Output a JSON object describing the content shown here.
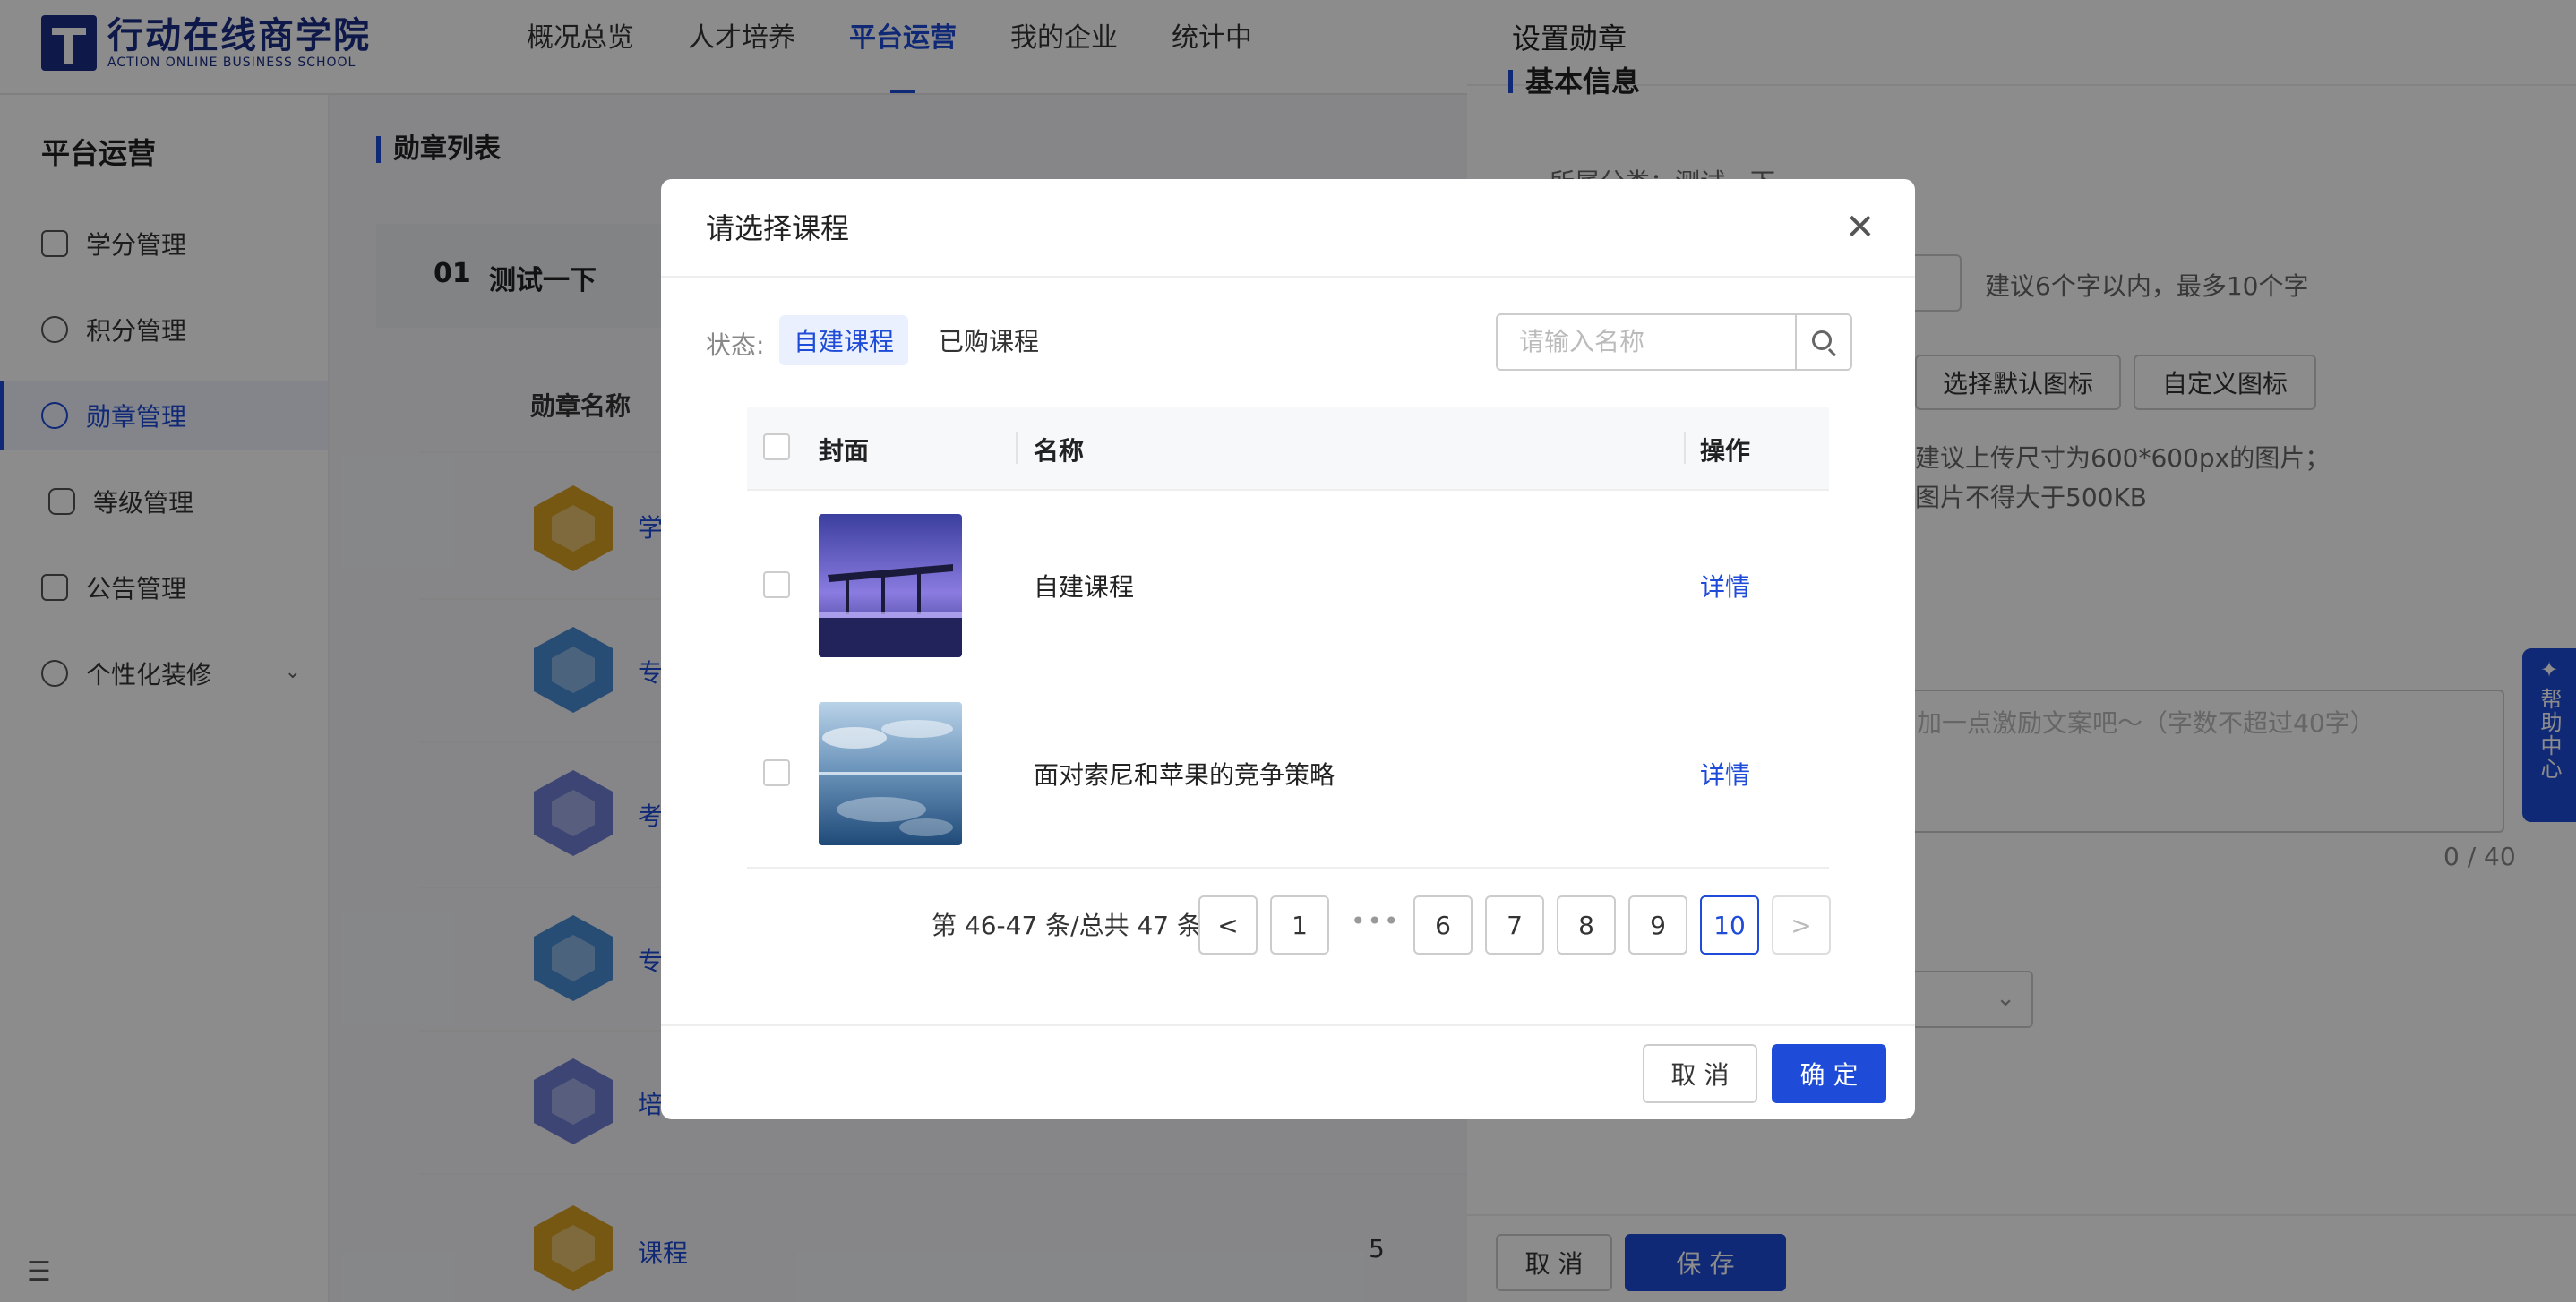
{
  "header": {
    "logo_cn": "行动在线商学院",
    "logo_en": "ACTION ONLINE BUSINESS SCHOOL",
    "nav": [
      "概况总览",
      "人才培养",
      "平台运营",
      "我的企业",
      "统计中"
    ],
    "active_nav": 2
  },
  "sidebar": {
    "title": "平台运营",
    "items": [
      {
        "label": "学分管理",
        "icon": "book-icon"
      },
      {
        "label": "积分管理",
        "icon": "database-icon"
      },
      {
        "label": "勋章管理",
        "icon": "medal-icon"
      },
      {
        "label": "等级管理",
        "icon": "level-icon"
      },
      {
        "label": "公告管理",
        "icon": "megaphone-icon"
      },
      {
        "label": "个性化装修",
        "icon": "palette-icon"
      }
    ],
    "active_index": 2
  },
  "main": {
    "title": "勋章列表",
    "group_no": "01",
    "group_name": "测试一下",
    "column": "勋章名称",
    "rows": [
      {
        "label": "学",
        "count": ""
      },
      {
        "label": "专",
        "count": ""
      },
      {
        "label": "考",
        "count": ""
      },
      {
        "label": "专",
        "count": ""
      },
      {
        "label": "培",
        "count": ""
      },
      {
        "label": "课程",
        "count": "5"
      }
    ]
  },
  "drawer": {
    "title": "设置勋章",
    "section": "基本信息",
    "category": "所属分类：测试一下",
    "name_hint": "建议6个字以内，最多10个字",
    "btn_default_icon": "选择默认图标",
    "btn_custom_icon": "自定义图标",
    "upload_hint_1": "建议上传尺寸为600*600px的图片；",
    "upload_hint_2": "图片不得大于500KB",
    "textarea_placeholder": "加一点激励文案吧～（字数不超过40字）",
    "counter": "0 / 40",
    "cancel": "取 消",
    "save": "保 存"
  },
  "help": {
    "label": "帮助中心"
  },
  "modal": {
    "title": "请选择课程",
    "status_label": "状态:",
    "tabs": [
      "自建课程",
      "已购课程"
    ],
    "active_tab": 0,
    "search_placeholder": "请输入名称",
    "columns": {
      "cover": "封面",
      "name": "名称",
      "op": "操作"
    },
    "rows": [
      {
        "name": "自建课程",
        "op": "详情",
        "cover": "night-pier-photo"
      },
      {
        "name": "面对索尼和苹果的竞争策略",
        "op": "详情",
        "cover": "sky-reflection-photo"
      }
    ],
    "pagination": {
      "info": "第 46-47 条/总共 47 条",
      "prev": "<",
      "next": ">",
      "pages": [
        "1",
        "6",
        "7",
        "8",
        "9",
        "10"
      ],
      "dots": "•••",
      "current": "10"
    },
    "cancel": "取 消",
    "ok": "确 定"
  }
}
